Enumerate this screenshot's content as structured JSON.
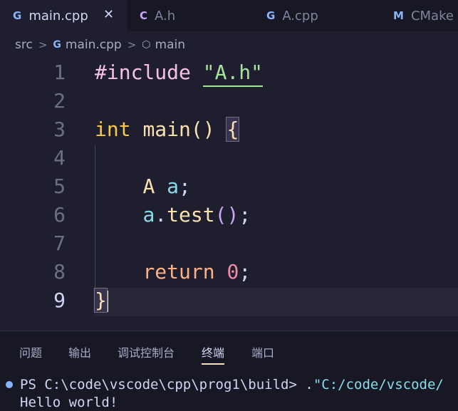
{
  "tabs": [
    {
      "icon": "G",
      "label": "main.cpp",
      "active": true
    },
    {
      "icon": "C",
      "label": "A.h"
    },
    {
      "icon": "G",
      "label": "A.cpp"
    },
    {
      "icon": "M",
      "label": "CMake"
    }
  ],
  "tab_close": "✕",
  "breadcrumb": {
    "folder": "src",
    "sep": ">",
    "file_icon": "G",
    "file": "main.cpp",
    "symbol_icon": "⬡",
    "symbol": "main"
  },
  "editor": {
    "line_numbers": [
      "1",
      "2",
      "3",
      "4",
      "5",
      "6",
      "7",
      "8",
      "9"
    ],
    "current_line": "9",
    "code": {
      "l1_directive": "#include",
      "l1_string": "\"A.h\"",
      "l3_type": "int",
      "l3_func": "main",
      "l3_parens": "()",
      "l3_brace": "{",
      "l5_type": "A",
      "l5_var": "a",
      "l5_semi": ";",
      "l6_obj": "a",
      "l6_dot": ".",
      "l6_method": "test",
      "l6_parens": "()",
      "l6_semi": ";",
      "l8_kw": "return",
      "l8_num": "0",
      "l8_semi": ";",
      "l9_brace": "}"
    }
  },
  "panel": {
    "tabs": [
      "问题",
      "输出",
      "调试控制台",
      "终端",
      "端口"
    ],
    "active_tab": "终端",
    "terminal": {
      "prompt": "PS C:\\code\\vscode\\cpp\\prog1\\build> .",
      "path": "\"C:/code/vscode/",
      "output": "Hello world!"
    }
  },
  "colors": {
    "background": "#1e1e2e",
    "tab_icon_cpp": "#89b4fa",
    "tab_icon_h": "#cba6f7",
    "tab_icon_cmake": "#89b4fa",
    "string": "#a6e3a1",
    "keyword_type": "#f9c74f",
    "number": "#f38ba8"
  }
}
